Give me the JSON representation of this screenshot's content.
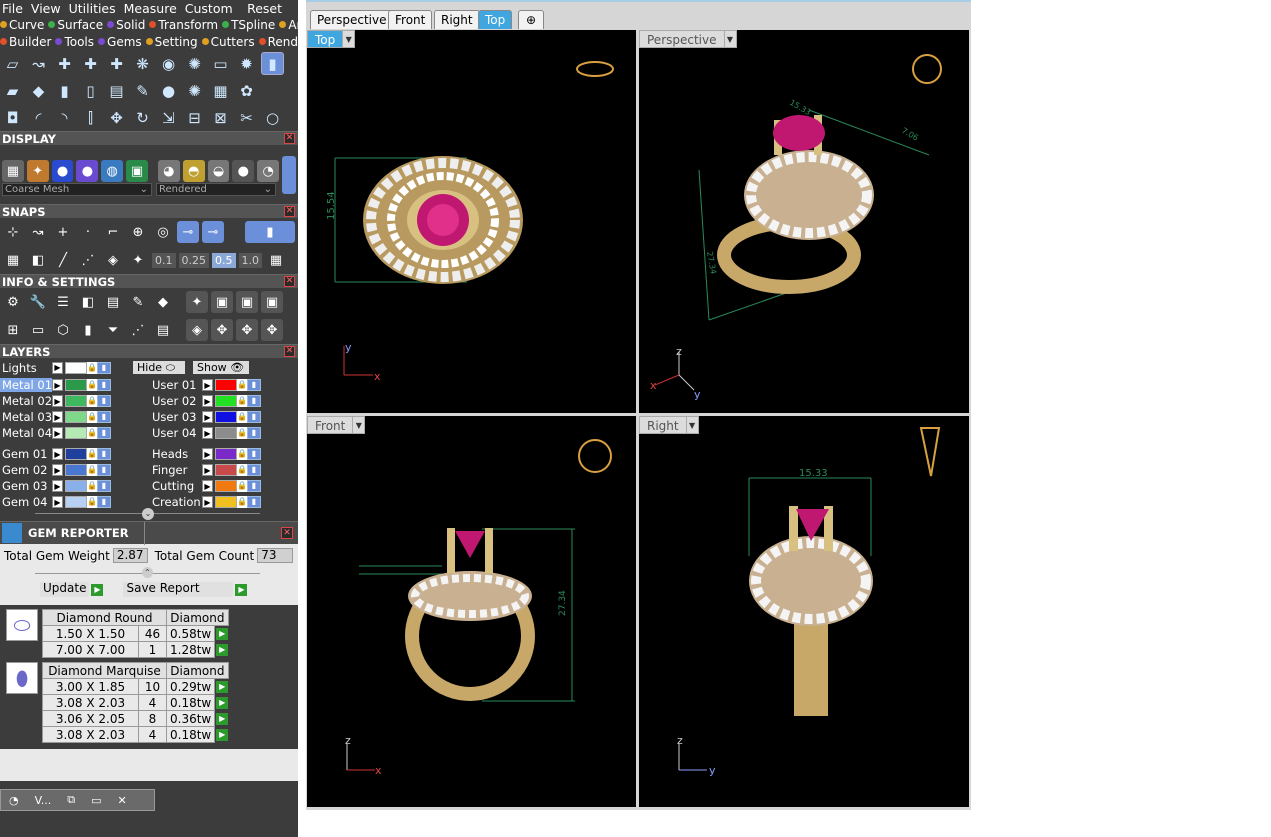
{
  "menu": {
    "items": [
      "File",
      "View",
      "Utilities",
      "Measure",
      "Custom"
    ],
    "reset": "Reset"
  },
  "plugins_row1": [
    "Curve",
    "Surface",
    "Solid",
    "Transform",
    "TSpline",
    "Art"
  ],
  "plugins_row2": [
    "Builder",
    "Tools",
    "Gems",
    "Setting",
    "Cutters",
    "Render"
  ],
  "display": {
    "title": "DISPLAY",
    "mesh": "Coarse Mesh",
    "mode": "Rendered"
  },
  "snaps": {
    "title": "SNAPS",
    "values": [
      "0.1",
      "0.25",
      "0.5",
      "1.0"
    ]
  },
  "info": {
    "title": "INFO & SETTINGS"
  },
  "layers": {
    "title": "LAYERS",
    "lights": "Lights",
    "hide": "Hide",
    "show": "Show",
    "left": [
      {
        "name": "Metal 01",
        "color": "#2a9a4a"
      },
      {
        "name": "Metal 02",
        "color": "#3fb860"
      },
      {
        "name": "Metal 03",
        "color": "#7fd88a"
      },
      {
        "name": "Metal 04",
        "color": "#b5eab5"
      },
      {
        "name": "Gem 01",
        "color": "#1e3f9c"
      },
      {
        "name": "Gem 02",
        "color": "#4a78d0"
      },
      {
        "name": "Gem 03",
        "color": "#8ab0ea"
      },
      {
        "name": "Gem 04",
        "color": "#b8d0f4"
      }
    ],
    "right": [
      {
        "name": "User 01",
        "color": "#ff0000"
      },
      {
        "name": "User 02",
        "color": "#22e022"
      },
      {
        "name": "User 03",
        "color": "#1010e0"
      },
      {
        "name": "User 04",
        "color": "#8c8c8c"
      },
      {
        "name": "Heads",
        "color": "#7a2ac8"
      },
      {
        "name": "Finger",
        "color": "#c84a4a"
      },
      {
        "name": "Cutting",
        "color": "#f07a10"
      },
      {
        "name": "Creation",
        "color": "#f0c020"
      }
    ]
  },
  "gem_reporter": {
    "title": "GEM REPORTER",
    "weight_label": "Total Gem Weight",
    "weight": "2.87",
    "count_label": "Total Gem Count",
    "count": "73",
    "update": "Update",
    "save": "Save Report",
    "groups": [
      {
        "shape": "Diamond Round",
        "material": "Diamond",
        "rows": [
          [
            "1.50 X 1.50",
            "46",
            "0.58tw"
          ],
          [
            "7.00 X 7.00",
            "1",
            "1.28tw"
          ]
        ]
      },
      {
        "shape": "Diamond Marquise",
        "material": "Diamond",
        "rows": [
          [
            "3.00 X 1.85",
            "10",
            "0.29tw"
          ],
          [
            "3.08 X 2.03",
            "4",
            "0.18tw"
          ],
          [
            "3.06 X 2.05",
            "8",
            "0.36tw"
          ],
          [
            "3.08 X 2.03",
            "4",
            "0.18tw"
          ]
        ]
      }
    ]
  },
  "taskbar": {
    "label": "V..."
  },
  "tabs": [
    "Perspective",
    "Front",
    "Right",
    "Top"
  ],
  "viewports": {
    "top": {
      "label": "Top",
      "dim": "15.54"
    },
    "perspective": {
      "label": "Perspective",
      "dim1": "15.33",
      "dim2": "7.06",
      "dim3": "27.34"
    },
    "front": {
      "label": "Front",
      "dim": "27.34"
    },
    "right": {
      "label": "Right",
      "dim": "15.33"
    }
  }
}
